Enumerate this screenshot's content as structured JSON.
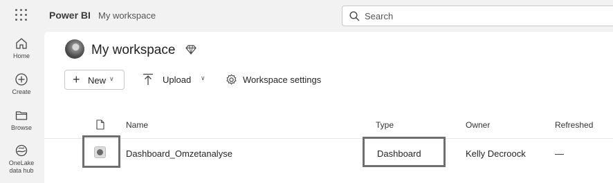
{
  "topbar": {
    "brand": "Power BI",
    "breadcrumb": "My workspace",
    "search_placeholder": "Search"
  },
  "leftnav": {
    "items": [
      {
        "label": "Home",
        "icon": "home-icon"
      },
      {
        "label": "Create",
        "icon": "plus-circle-icon"
      },
      {
        "label": "Browse",
        "icon": "folder-icon"
      },
      {
        "label_line1": "OneLake",
        "label_line2": "data hub",
        "icon": "onelake-icon"
      }
    ]
  },
  "workspace": {
    "title": "My workspace",
    "premium_icon": "diamond-icon"
  },
  "toolbar": {
    "new_label": "New",
    "upload_label": "Upload",
    "settings_label": "Workspace settings"
  },
  "table": {
    "headers": {
      "icon": "file-icon",
      "name": "Name",
      "type": "Type",
      "owner": "Owner",
      "refreshed": "Refreshed"
    },
    "rows": [
      {
        "icon": "dashboard-icon",
        "name": "Dashboard_Omzetanalyse",
        "type": "Dashboard",
        "owner": "Kelly Decroock",
        "refreshed": "—"
      }
    ]
  },
  "colors": {
    "background": "#f2f2f2",
    "content": "#ffffff",
    "highlight_border": "#6e6e6e"
  }
}
